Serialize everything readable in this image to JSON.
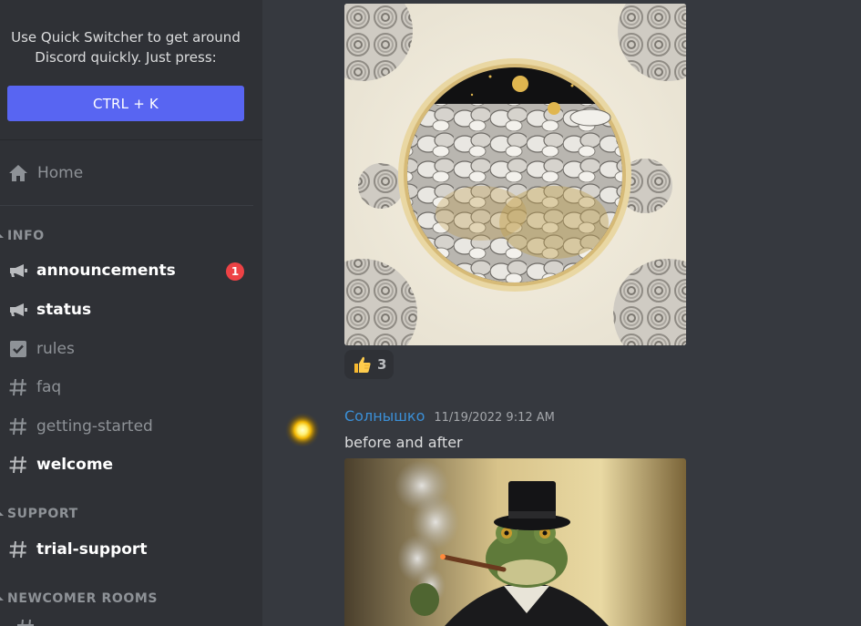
{
  "quick_switcher": {
    "line1": "Use Quick Switcher to get around",
    "line2": "Discord quickly. Just press:",
    "shortcut": "CTRL + K"
  },
  "home": {
    "label": "Home"
  },
  "categories": {
    "info": "INFO",
    "support": "SUPPORT",
    "newcomer": "NEWCOMER ROOMS"
  },
  "channels": [
    {
      "name": "announcements",
      "icon": "megaphone-icon",
      "unread": true,
      "mentions": "1"
    },
    {
      "name": "status",
      "icon": "megaphone-icon",
      "unread": true
    },
    {
      "name": "rules",
      "icon": "checkbox-icon",
      "unread": false
    },
    {
      "name": "faq",
      "icon": "hash-icon",
      "unread": false
    },
    {
      "name": "getting-started",
      "icon": "hash-icon",
      "unread": false
    },
    {
      "name": "welcome",
      "icon": "hash-icon",
      "unread": true
    },
    {
      "name": "trial-support",
      "icon": "hash-icon",
      "unread": true
    }
  ],
  "messages": {
    "first": {
      "attachment": "image-clouds-moon",
      "reaction": {
        "emoji": "thumbs-up-icon",
        "count": "3"
      }
    },
    "second": {
      "author": "Солнышко",
      "timestamp": "11/19/2022 9:12 AM",
      "text": "before and after",
      "attachment": "image-frog-top-hat"
    }
  },
  "colors": {
    "blurple": "#5865f2",
    "sidebar_bg": "#2f3136",
    "chat_bg": "#36393f",
    "mention_red": "#ed4245",
    "username_blue": "#3b8fd6"
  }
}
